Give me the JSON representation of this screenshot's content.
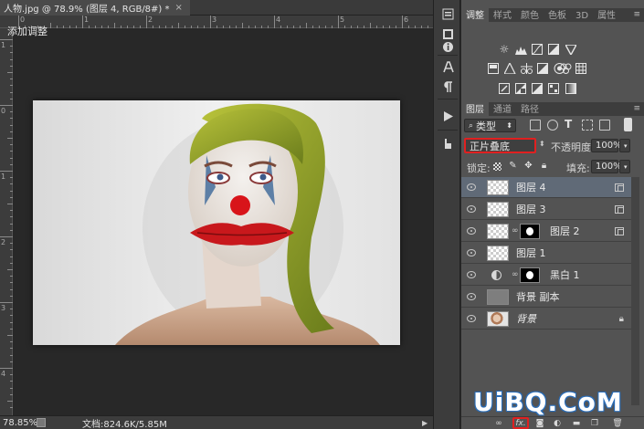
{
  "document": {
    "tab_title": "人物.jpg @ 78.9% (图层 4, RGB/8#) *",
    "tab_close": "×"
  },
  "rulers": {
    "top_labels": [
      "0",
      "1",
      "2",
      "3",
      "4",
      "5",
      "6"
    ],
    "left_labels": [
      "1",
      "0",
      "1",
      "2",
      "3",
      "4"
    ]
  },
  "statusbar": {
    "zoom": "78.85%",
    "doc_info": "文档:824.6K/5.85M",
    "arrow": "▶"
  },
  "mid_toolbar": {
    "icons": [
      "history-icon",
      "info-icon",
      "character-icon",
      "paragraph-icon",
      "actions-icon",
      "tool-presets-icon"
    ]
  },
  "adjustments_panel": {
    "tabs": [
      "调整",
      "样式",
      "颜色",
      "色板",
      "3D",
      "属性"
    ],
    "active_tab": "调整",
    "title": "添加调整",
    "icons_row1": [
      "brightness-icon",
      "levels-icon",
      "curves-icon",
      "exposure-icon",
      "triangle-icon"
    ],
    "icons_row2": [
      "vibrance-icon",
      "color-balance-icon",
      "black-white-icon",
      "photo-filter-icon",
      "channel-mixer-icon",
      "color-lookup-icon"
    ],
    "icons_row3": [
      "invert-icon",
      "posterize-icon",
      "threshold-icon",
      "selective-color-icon",
      "gradient-map-icon"
    ]
  },
  "layers_panel": {
    "tabs": [
      "图层",
      "通道",
      "路径"
    ],
    "active_tab": "图层",
    "filter_kind": "类型",
    "blend_mode": "正片叠底",
    "opacity_label": "不透明度:",
    "opacity_value": "100%",
    "lock_label": "锁定:",
    "fill_label": "填充:",
    "fill_value": "100%",
    "layers": [
      {
        "name": "图层 4",
        "selected": true,
        "thumb": "transparent",
        "mask": false,
        "adjustment": false,
        "badge": "smart"
      },
      {
        "name": "图层 3",
        "selected": false,
        "thumb": "transparent",
        "mask": false,
        "adjustment": false,
        "badge": "smart"
      },
      {
        "name": "图层 2",
        "selected": false,
        "thumb": "transparent",
        "mask": true,
        "adjustment": false,
        "badge": "smart"
      },
      {
        "name": "图层 1",
        "selected": false,
        "thumb": "transparent",
        "mask": false,
        "adjustment": false,
        "badge": ""
      },
      {
        "name": "黑白 1",
        "selected": false,
        "thumb": "none",
        "mask": true,
        "adjustment": true,
        "badge": ""
      },
      {
        "name": "背景 副本",
        "selected": false,
        "thumb": "gray",
        "mask": false,
        "adjustment": false,
        "badge": ""
      },
      {
        "name": "背景",
        "selected": false,
        "thumb": "photo",
        "mask": false,
        "adjustment": false,
        "badge": "lock",
        "italic": true
      }
    ],
    "bottom_icons": [
      "link-icon",
      "fx-icon",
      "add-mask-icon",
      "new-adjustment-icon",
      "new-group-icon",
      "new-layer-icon",
      "delete-icon"
    ],
    "fx_label": "fx."
  },
  "watermark": "UiBQ.CoM",
  "colors": {
    "highlight_border": "#e02020",
    "selected_layer": "#606a77",
    "panel_bg": "#535353",
    "workspace_bg": "#282828"
  }
}
